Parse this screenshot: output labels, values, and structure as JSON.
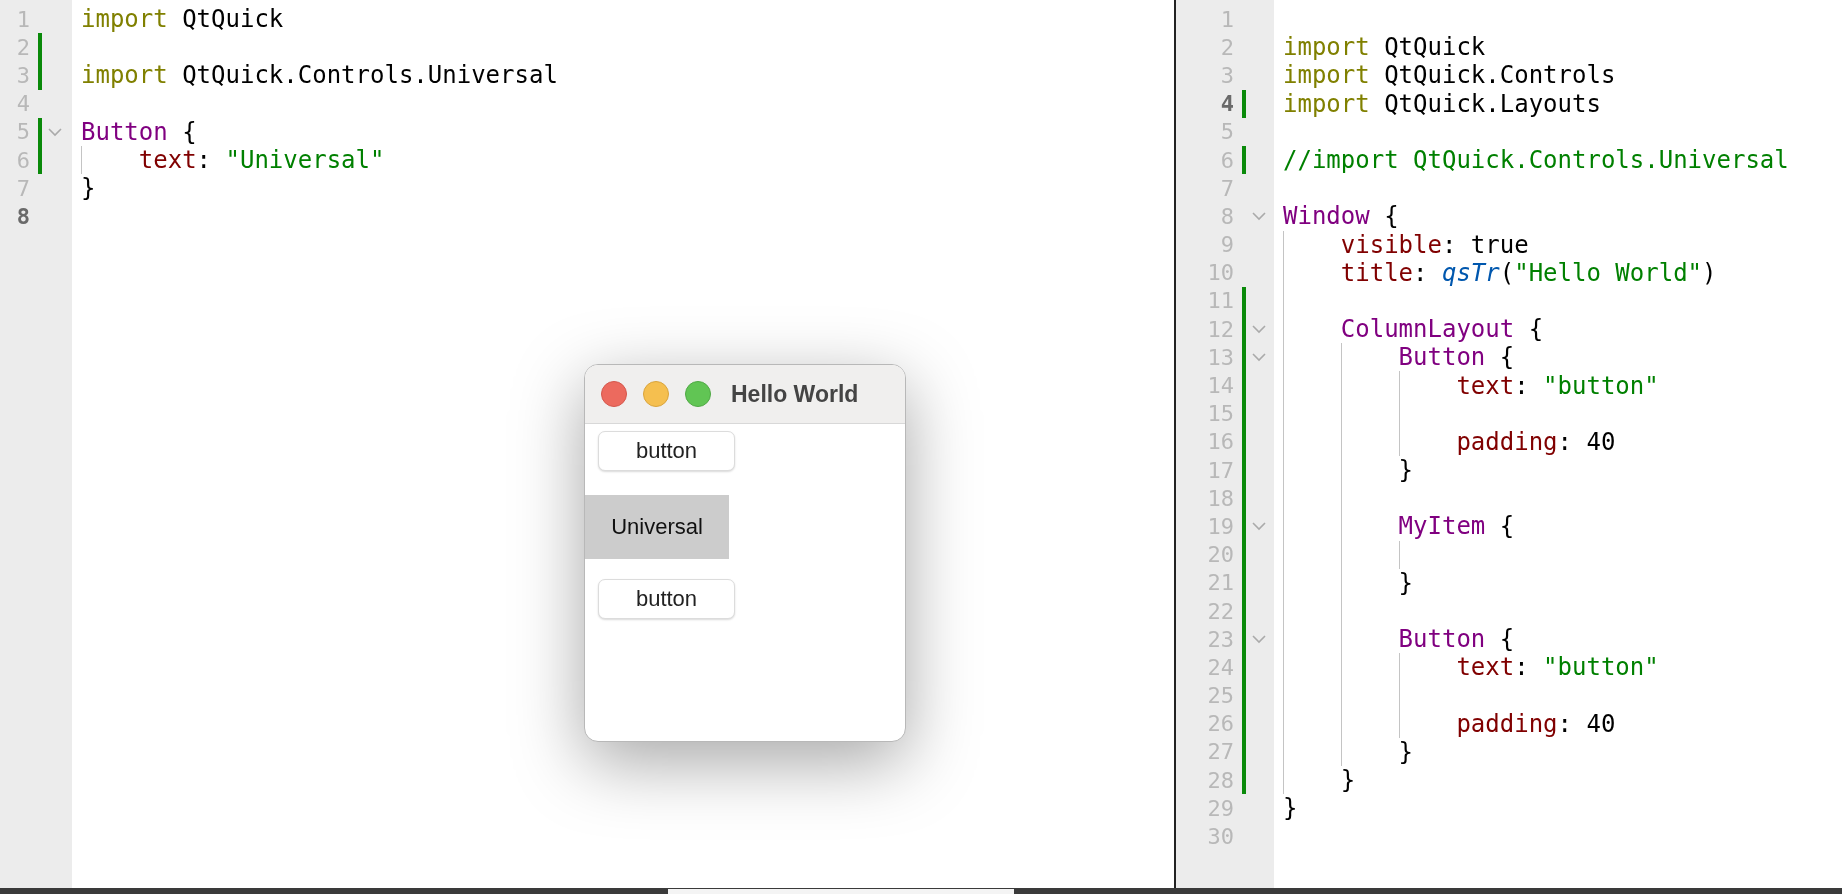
{
  "editors": [
    {
      "lines": [
        {
          "num": "1",
          "changed": false,
          "fold": false,
          "current": false,
          "tokens": [
            {
              "kind": "keyword",
              "text": "import"
            },
            {
              "kind": "plain",
              "text": " QtQuick"
            }
          ]
        },
        {
          "num": "2",
          "changed": true,
          "fold": false,
          "current": false
        },
        {
          "num": "3",
          "changed": true,
          "fold": false,
          "current": false,
          "tokens": [
            {
              "kind": "keyword",
              "text": "import"
            },
            {
              "kind": "plain",
              "text": " QtQuick.Controls.Universal"
            }
          ]
        },
        {
          "num": "4",
          "changed": false,
          "fold": false,
          "current": false
        },
        {
          "num": "5",
          "changed": true,
          "fold": true,
          "current": false,
          "tokens": [
            {
              "kind": "type",
              "text": "Button"
            },
            {
              "kind": "plain",
              "text": " {"
            }
          ],
          "children": [
            {
              "num": "6",
              "changed": true,
              "fold": false,
              "current": false,
              "tokens": [
                {
                  "kind": "prop",
                  "text": "text"
                },
                {
                  "kind": "plain",
                  "text": ": "
                },
                {
                  "kind": "string",
                  "text": "\"Universal\""
                }
              ]
            }
          ]
        },
        {
          "num": "7",
          "changed": false,
          "fold": false,
          "current": false,
          "tokens": [
            {
              "kind": "plain",
              "text": "}"
            }
          ]
        },
        {
          "num": "8",
          "changed": false,
          "fold": false,
          "current": true
        }
      ]
    },
    {
      "lines": [
        {
          "num": "1",
          "changed": false,
          "fold": false,
          "current": false
        },
        {
          "num": "2",
          "changed": false,
          "fold": false,
          "current": false,
          "tokens": [
            {
              "kind": "keyword",
              "text": "import"
            },
            {
              "kind": "plain",
              "text": " QtQuick"
            }
          ]
        },
        {
          "num": "3",
          "changed": false,
          "fold": false,
          "current": false,
          "tokens": [
            {
              "kind": "keyword",
              "text": "import"
            },
            {
              "kind": "plain",
              "text": " QtQuick.Controls"
            }
          ]
        },
        {
          "num": "4",
          "changed": true,
          "fold": false,
          "current": true,
          "tokens": [
            {
              "kind": "keyword",
              "text": "import"
            },
            {
              "kind": "plain",
              "text": " QtQuick.Layouts"
            }
          ]
        },
        {
          "num": "5",
          "changed": false,
          "fold": false,
          "current": false
        },
        {
          "num": "6",
          "changed": true,
          "fold": false,
          "current": false,
          "tokens": [
            {
              "kind": "comment",
              "text": "//import QtQuick.Controls.Universal"
            }
          ]
        },
        {
          "num": "7",
          "changed": false,
          "fold": false,
          "current": false
        },
        {
          "num": "8",
          "changed": false,
          "fold": true,
          "current": false,
          "tokens": [
            {
              "kind": "type",
              "text": "Window"
            },
            {
              "kind": "plain",
              "text": " {"
            }
          ],
          "children": [
            {
              "num": "9",
              "changed": false,
              "fold": false,
              "current": false,
              "tokens": [
                {
                  "kind": "prop",
                  "text": "visible"
                },
                {
                  "kind": "plain",
                  "text": ": true"
                }
              ]
            },
            {
              "num": "10",
              "changed": false,
              "fold": false,
              "current": false,
              "tokens": [
                {
                  "kind": "prop",
                  "text": "title"
                },
                {
                  "kind": "plain",
                  "text": ": "
                },
                {
                  "kind": "func",
                  "text": "qsTr"
                },
                {
                  "kind": "plain",
                  "text": "("
                },
                {
                  "kind": "string",
                  "text": "\"Hello World\""
                },
                {
                  "kind": "plain",
                  "text": ")"
                }
              ]
            },
            {
              "num": "11",
              "changed": true,
              "fold": false,
              "current": false
            },
            {
              "num": "12",
              "changed": true,
              "fold": true,
              "current": false,
              "tokens": [
                {
                  "kind": "type",
                  "text": "ColumnLayout"
                },
                {
                  "kind": "plain",
                  "text": " {"
                }
              ],
              "children": [
                {
                  "num": "13",
                  "changed": true,
                  "fold": true,
                  "current": false,
                  "tokens": [
                    {
                      "kind": "type",
                      "text": "Button"
                    },
                    {
                      "kind": "plain",
                      "text": " {"
                    }
                  ],
                  "children": [
                    {
                      "num": "14",
                      "changed": true,
                      "fold": false,
                      "current": false,
                      "tokens": [
                        {
                          "kind": "prop",
                          "text": "text"
                        },
                        {
                          "kind": "plain",
                          "text": ": "
                        },
                        {
                          "kind": "string",
                          "text": "\"button\""
                        }
                      ]
                    },
                    {
                      "num": "15",
                      "changed": true,
                      "fold": false,
                      "current": false
                    },
                    {
                      "num": "16",
                      "changed": true,
                      "fold": false,
                      "current": false,
                      "tokens": [
                        {
                          "kind": "prop",
                          "text": "padding"
                        },
                        {
                          "kind": "plain",
                          "text": ": 40"
                        }
                      ]
                    }
                  ]
                },
                {
                  "num": "17",
                  "changed": true,
                  "fold": false,
                  "current": false,
                  "tokens": [
                    {
                      "kind": "plain",
                      "text": "}"
                    }
                  ]
                },
                {
                  "num": "18",
                  "changed": true,
                  "fold": false,
                  "current": false
                },
                {
                  "num": "19",
                  "changed": true,
                  "fold": true,
                  "current": false,
                  "tokens": [
                    {
                      "kind": "type",
                      "text": "MyItem"
                    },
                    {
                      "kind": "plain",
                      "text": " {"
                    }
                  ],
                  "children": [
                    {
                      "num": "20",
                      "changed": true,
                      "fold": false,
                      "current": false
                    }
                  ]
                },
                {
                  "num": "21",
                  "changed": true,
                  "fold": false,
                  "current": false,
                  "tokens": [
                    {
                      "kind": "plain",
                      "text": "}"
                    }
                  ]
                },
                {
                  "num": "22",
                  "changed": true,
                  "fold": false,
                  "current": false
                },
                {
                  "num": "23",
                  "changed": true,
                  "fold": true,
                  "current": false,
                  "tokens": [
                    {
                      "kind": "type",
                      "text": "Button"
                    },
                    {
                      "kind": "plain",
                      "text": " {"
                    }
                  ],
                  "children": [
                    {
                      "num": "24",
                      "changed": true,
                      "fold": false,
                      "current": false,
                      "tokens": [
                        {
                          "kind": "prop",
                          "text": "text"
                        },
                        {
                          "kind": "plain",
                          "text": ": "
                        },
                        {
                          "kind": "string",
                          "text": "\"button\""
                        }
                      ]
                    },
                    {
                      "num": "25",
                      "changed": true,
                      "fold": false,
                      "current": false
                    },
                    {
                      "num": "26",
                      "changed": true,
                      "fold": false,
                      "current": false,
                      "tokens": [
                        {
                          "kind": "prop",
                          "text": "padding"
                        },
                        {
                          "kind": "plain",
                          "text": ": 40"
                        }
                      ]
                    }
                  ]
                },
                {
                  "num": "27",
                  "changed": true,
                  "fold": false,
                  "current": false,
                  "tokens": [
                    {
                      "kind": "plain",
                      "text": "}"
                    }
                  ]
                }
              ]
            },
            {
              "num": "28",
              "changed": true,
              "fold": false,
              "current": false,
              "tokens": [
                {
                  "kind": "plain",
                  "text": "}"
                }
              ]
            }
          ]
        },
        {
          "num": "29",
          "changed": false,
          "fold": false,
          "current": false,
          "tokens": [
            {
              "kind": "plain",
              "text": "}"
            }
          ]
        },
        {
          "num": "30",
          "changed": false,
          "fold": false,
          "current": false
        }
      ]
    }
  ],
  "app_window": {
    "title": "Hello World",
    "items": [
      {
        "kind": "button",
        "text": "button"
      },
      {
        "kind": "universal",
        "text": "Universal"
      },
      {
        "kind": "button",
        "text": "button"
      }
    ]
  }
}
